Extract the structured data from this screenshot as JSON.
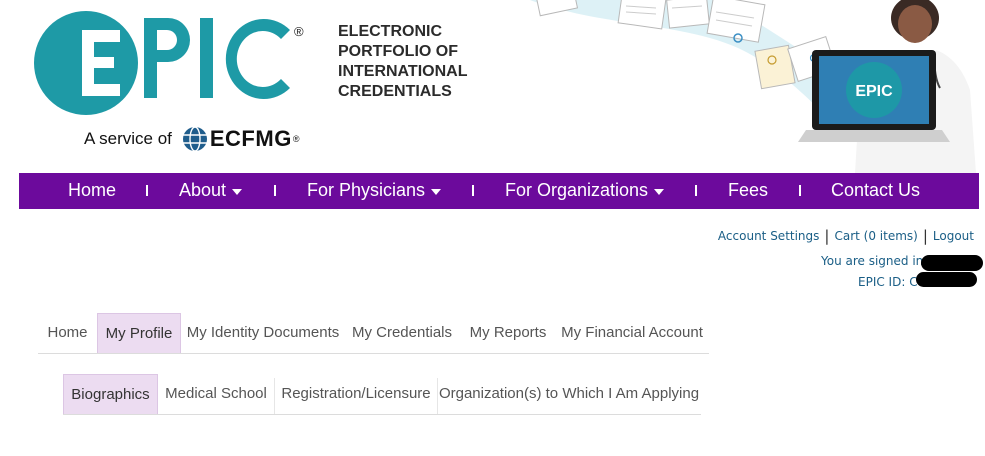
{
  "brand": {
    "logo_text": "EPIC",
    "registered_mark": "®",
    "tagline_lines": [
      "ELECTRONIC",
      "PORTFOLIO OF",
      "INTERNATIONAL",
      "CREDENTIALS"
    ],
    "service_text": "A service of",
    "parent_org": "ECFMG",
    "parent_org_mark": "®",
    "laptop_logo_text": "EPIC"
  },
  "colors": {
    "brand_teal": "#1e9aa6",
    "nav_purple": "#6c0a9c",
    "link_blue": "#1a5e86",
    "active_tab_bg": "#ecdcf1"
  },
  "main_nav": {
    "items": [
      {
        "label": "Home",
        "dropdown": false
      },
      {
        "label": "About",
        "dropdown": true
      },
      {
        "label": "For Physicians",
        "dropdown": true
      },
      {
        "label": "For Organizations",
        "dropdown": true
      },
      {
        "label": "Fees",
        "dropdown": false
      },
      {
        "label": "Contact Us",
        "dropdown": false
      }
    ]
  },
  "account": {
    "settings_label": "Account Settings",
    "cart_label": "Cart (0 items)",
    "logout_label": "Logout",
    "signed_in_text": "You are signed in a",
    "epic_id_text": "EPIC ID: C"
  },
  "profile_tabs": {
    "items": [
      "Home",
      "My Profile",
      "My Identity Documents",
      "My Credentials",
      "My Reports",
      "My Financial Account"
    ],
    "active": "My Profile"
  },
  "profile_subtabs": {
    "items": [
      "Biographics",
      "Medical School",
      "Registration/Licensure",
      "Organization(s) to Which I Am Applying"
    ],
    "active": "Biographics"
  }
}
